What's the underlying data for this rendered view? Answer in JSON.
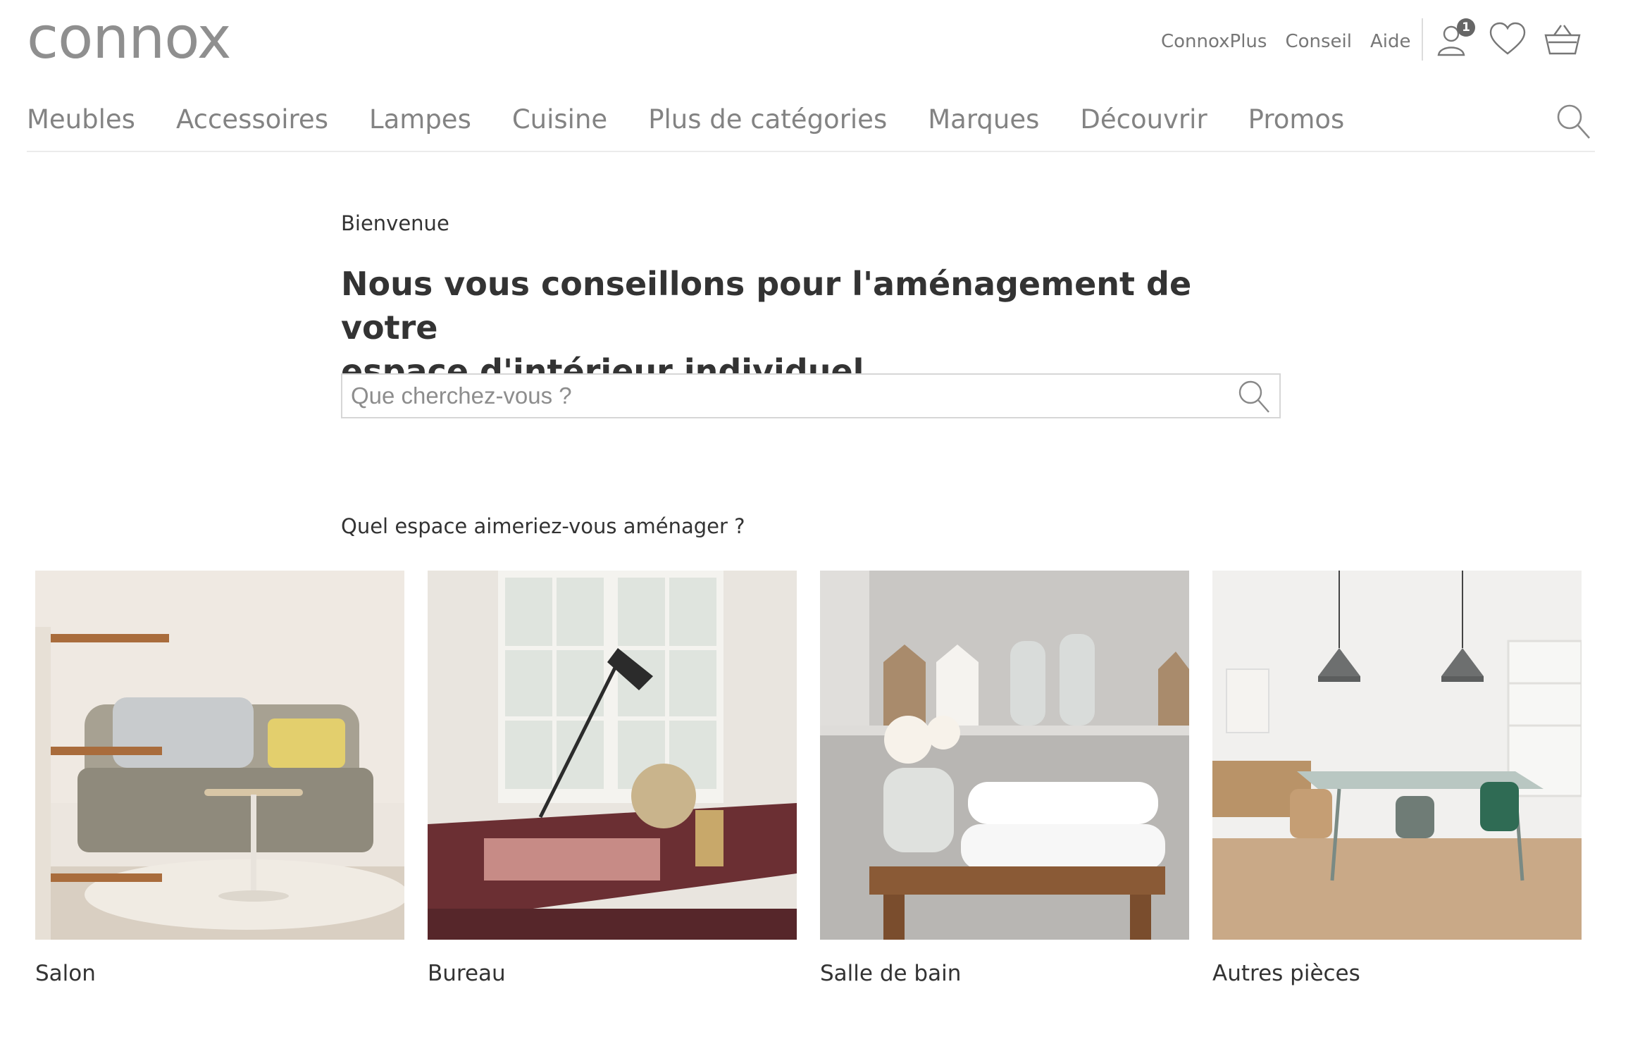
{
  "brand": {
    "logo_text": "connox"
  },
  "utility_nav": {
    "links": [
      "ConnoxPlus",
      "Conseil",
      "Aide"
    ],
    "account_badge": "1",
    "icons": [
      "user-icon",
      "heart-icon",
      "basket-icon"
    ]
  },
  "main_nav": {
    "items": [
      "Meubles",
      "Accessoires",
      "Lampes",
      "Cuisine",
      "Plus de catégories",
      "Marques",
      "Découvrir",
      "Promos"
    ],
    "search_icon": "search-icon"
  },
  "hero": {
    "welcome": "Bienvenue",
    "headline_line1": "Nous vous conseillons pour l'aménagement de votre",
    "headline_line2": "espace d'intérieur individuel.",
    "search_placeholder": "Que cherchez-vous ?"
  },
  "rooms": {
    "question": "Quel espace aimeriez-vous aménager ?",
    "items": [
      {
        "label": "Salon"
      },
      {
        "label": "Bureau"
      },
      {
        "label": "Salle de bain"
      },
      {
        "label": "Autres pièces"
      }
    ]
  },
  "colors": {
    "logo": "#8f8f8f",
    "nav_text": "#838383",
    "body_text": "#333333",
    "border": "#d6d6d6"
  }
}
